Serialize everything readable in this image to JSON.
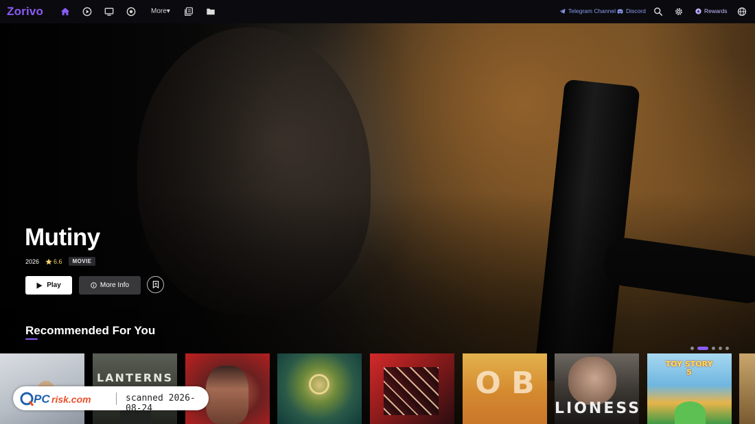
{
  "nav": {
    "logo": "Zorivo",
    "more_label": "More▾",
    "telegram_label": "Telegram Channel",
    "discord_label": "Discord",
    "rewards_label": "Rewards",
    "icons": [
      "home-icon",
      "play-circle-icon",
      "tv-icon",
      "disc-icon",
      "library-icon",
      "folder-icon",
      "search-icon",
      "gear-icon",
      "globe-icon"
    ]
  },
  "hero": {
    "title": "Mutiny",
    "year": "2026",
    "rating": "6.6",
    "type": "MOVIE",
    "play_label": "Play",
    "info_label": "More Info"
  },
  "recommended": {
    "title": "Recommended For You",
    "carousel": {
      "pages": 5,
      "active": 1
    },
    "posters": [
      {
        "name": "poster-1",
        "text": ""
      },
      {
        "name": "poster-lanterns",
        "text": "LANTERNS"
      },
      {
        "name": "poster-3",
        "text": ""
      },
      {
        "name": "poster-4",
        "text": ""
      },
      {
        "name": "poster-5",
        "text": ""
      },
      {
        "name": "poster-obx",
        "text": "O B"
      },
      {
        "name": "poster-lioness",
        "text": "LIONESS"
      },
      {
        "name": "poster-toy-story-5",
        "text": "TOY STORY 5"
      }
    ]
  },
  "watermark": {
    "logo_text": "PCrisk.com",
    "scan_text": "scanned 2026-08-24"
  },
  "colors": {
    "accent": "#8b5cf6",
    "link": "#8b9cf0",
    "star": "#f5d36b"
  }
}
